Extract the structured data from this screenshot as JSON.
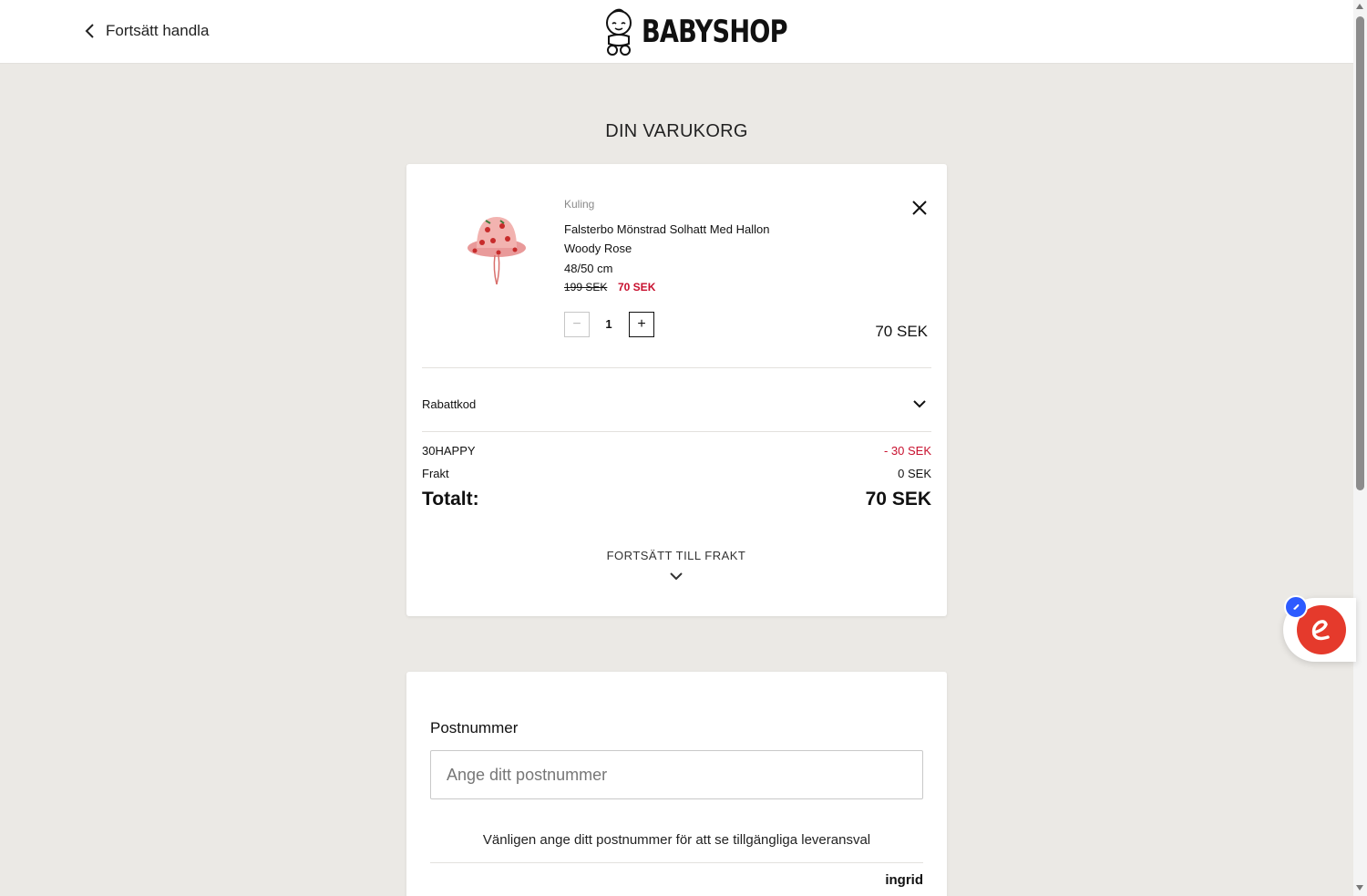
{
  "header": {
    "back_label": "Fortsätt handla",
    "logo_text": "BABYSHOP"
  },
  "page_title": "DIN VARUKORG",
  "cart": {
    "item": {
      "brand": "Kuling",
      "name_line1": "Falsterbo Mönstrad Solhatt Med Hallon",
      "name_line2": "Woody Rose",
      "size": "48/50 cm",
      "old_price": "199 SEK",
      "new_price": "70 SEK",
      "quantity": "1",
      "line_total": "70 SEK",
      "minus_label": "−",
      "plus_label": "+"
    },
    "discount_label": "Rabattkod",
    "summary": {
      "code_label": "30HAPPY",
      "code_value": "- 30 SEK",
      "shipping_label": "Frakt",
      "shipping_value": "0 SEK",
      "total_label": "Totalt:",
      "total_value": "70 SEK"
    },
    "continue_label": "FORTSÄTT TILL FRAKT"
  },
  "shipping": {
    "postal_label": "Postnummer",
    "postal_placeholder": "Ange ditt postnummer",
    "postal_value": "",
    "hint": "Vänligen ange ditt postnummer för att se tillgängliga leveransval",
    "provider": "ingrid"
  },
  "colors": {
    "background": "#ebe9e5",
    "sale_red": "#c8102e",
    "widget_red": "#e53a2c",
    "badge_blue": "#2d5bff"
  },
  "icons": {
    "back": "chevron-left-icon",
    "close": "close-icon",
    "expand": "chevron-down-icon",
    "widget": "chat-widget-icon"
  }
}
